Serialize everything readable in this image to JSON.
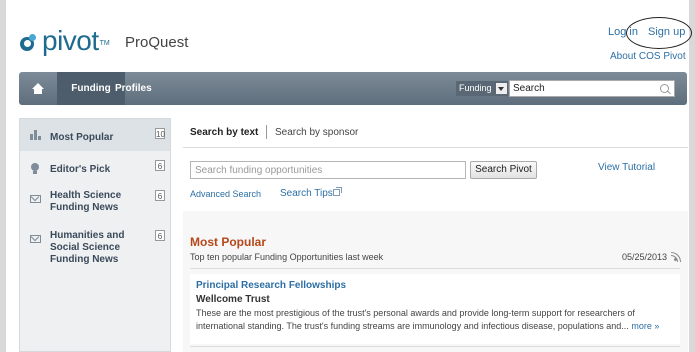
{
  "header": {
    "logo_text": "pivot",
    "logo_tm": "TM",
    "brand": "ProQuest",
    "login": "Log in",
    "signup": "Sign up",
    "about": "About COS Pivot"
  },
  "nav": {
    "tabs": [
      {
        "label": "Funding"
      },
      {
        "label": "Profiles"
      }
    ],
    "search_scope": "Funding",
    "search_value": "Search"
  },
  "sidebar": {
    "items": [
      {
        "label": "Most Popular",
        "count": "10",
        "icon": "bar-chart-icon"
      },
      {
        "label": "Editor's Pick",
        "count": "6",
        "icon": "lightbulb-icon"
      },
      {
        "label": "Health Science Funding News",
        "count": "6",
        "icon": "mail-icon"
      },
      {
        "label": "Humanities and Social Science Funding News",
        "count": "6",
        "icon": "mail-icon"
      }
    ]
  },
  "search": {
    "tab_text": "Search by text",
    "tab_sponsor": "Search by sponsor",
    "placeholder": "Search funding opportunities",
    "button": "Search Pivot",
    "view_tutorial": "View Tutorial",
    "advanced": "Advanced Search",
    "tips": "Search Tips"
  },
  "popular": {
    "title": "Most Popular",
    "subtitle": "Top ten popular Funding Opportunities last week",
    "date": "05/25/2013",
    "items": [
      {
        "title": "Principal Research Fellowships",
        "sponsor": "Wellcome Trust",
        "description": "These are the most prestigious of the trust's personal awards and provide long-term support for researchers of international standing. The trust's funding streams are immunology and infectious disease, populations and...",
        "more": "more »"
      }
    ]
  }
}
